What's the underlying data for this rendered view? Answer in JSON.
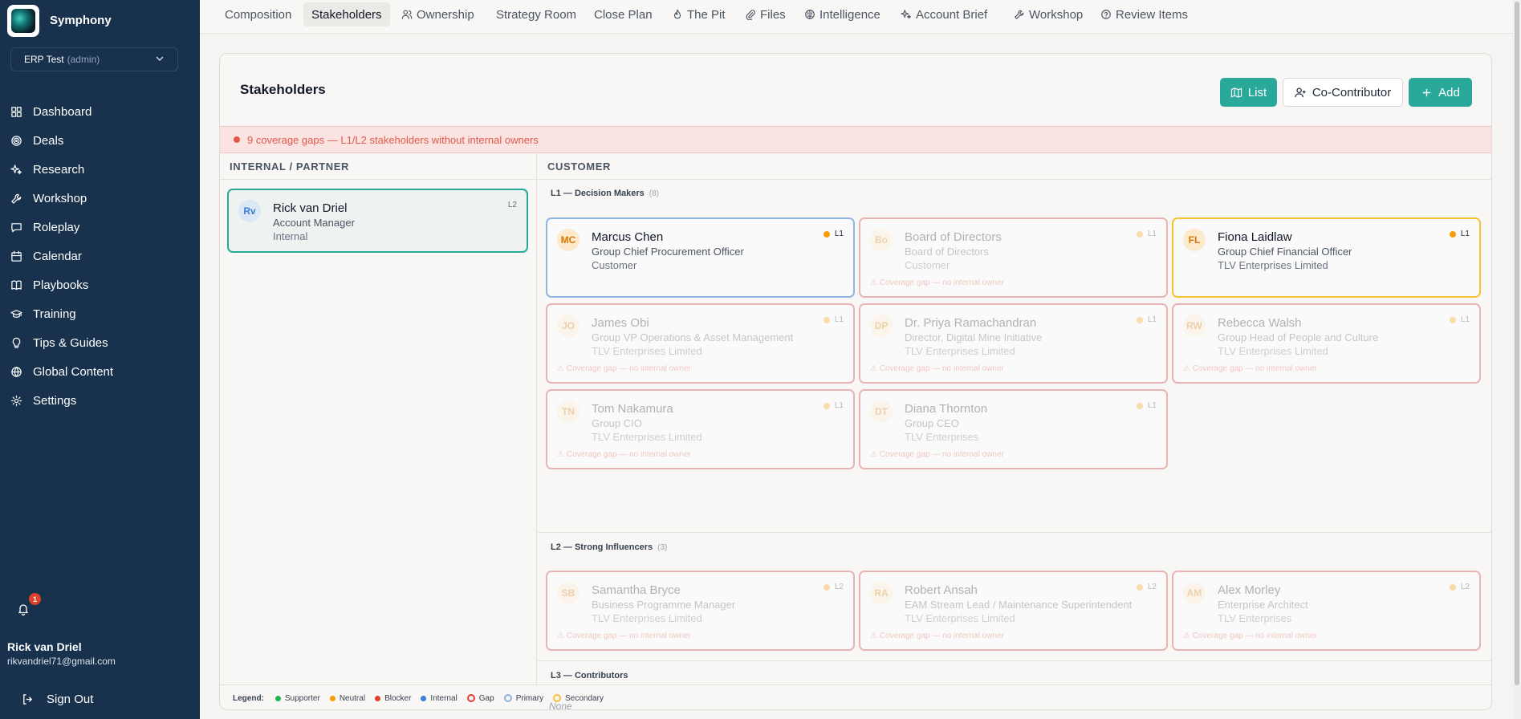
{
  "app": {
    "brand": "Symphony",
    "org": "ERP Test",
    "org_role": "(admin)"
  },
  "nav": [
    {
      "label": "Dashboard",
      "icon": "dashboard-icon"
    },
    {
      "label": "Deals",
      "icon": "target-icon"
    },
    {
      "label": "Research",
      "icon": "sparkle-icon"
    },
    {
      "label": "Workshop",
      "icon": "wrench-icon"
    },
    {
      "label": "Roleplay",
      "icon": "chat-icon"
    },
    {
      "label": "Calendar",
      "icon": "calendar-icon"
    },
    {
      "label": "Playbooks",
      "icon": "book-icon"
    },
    {
      "label": "Training",
      "icon": "graduation-cap-icon"
    },
    {
      "label": "Tips & Guides",
      "icon": "lightbulb-icon"
    },
    {
      "label": "Global Content",
      "icon": "globe-icon"
    },
    {
      "label": "Settings",
      "icon": "gear-icon"
    }
  ],
  "notifications": {
    "count": "1"
  },
  "user": {
    "name": "Rick van Driel",
    "email": "rikvandriel71@gmail.com",
    "signout": "Sign Out"
  },
  "tabs": [
    {
      "label": "Composition",
      "icon": ""
    },
    {
      "label": "Stakeholders",
      "icon": "",
      "active": true
    },
    {
      "label": "Ownership",
      "icon": "users-icon"
    },
    {
      "label": "Strategy Room",
      "icon": ""
    },
    {
      "label": "Close Plan",
      "icon": ""
    },
    {
      "label": "The Pit",
      "icon": "fire-icon"
    },
    {
      "label": "Files",
      "icon": "paperclip-icon"
    },
    {
      "label": "Intelligence",
      "icon": "brain-icon"
    },
    {
      "label": "Account Brief",
      "icon": "sparkle-icon"
    },
    {
      "label": "Workshop",
      "icon": "wrench-icon"
    },
    {
      "label": "Review Items",
      "icon": "help-circle-icon"
    }
  ],
  "panel": {
    "title": "Stakeholders",
    "buttons": {
      "list": "List",
      "cocontributor": "Co-Contributor",
      "add": "Add"
    },
    "gap_banner": "9 coverage gaps — L1/L2 stakeholders without internal owners",
    "internal_head": "INTERNAL / PARTNER",
    "customer_head": "CUSTOMER"
  },
  "internal": [
    {
      "initials": "Rv",
      "name": "Rick van Driel",
      "title": "Account Manager",
      "org": "Internal",
      "level": "L2"
    }
  ],
  "sections": [
    {
      "label": "L1 — Decision Makers",
      "count": "(8)"
    },
    {
      "label": "L2 — Strong Influencers",
      "count": "(3)"
    },
    {
      "label": "L3 — Contributors",
      "count": "",
      "empty": "None"
    }
  ],
  "gap_note": "⚠ Coverage gap — no internal owner",
  "l1": [
    {
      "initials": "MC",
      "name": "Marcus Chen",
      "title": "Group Chief Procurement Officer",
      "org": "Customer",
      "level": "L1",
      "border": "#8fb5e3",
      "faded": false,
      "av": "orange",
      "gap": false
    },
    {
      "initials": "Bo",
      "name": "Board of Directors",
      "title": "Board of Directors",
      "org": "Customer",
      "level": "L1",
      "border": "#eab4b4",
      "faded": true,
      "av": "orange",
      "gap": true
    },
    {
      "initials": "FL",
      "name": "Fiona Laidlaw",
      "title": "Group Chief Financial Officer",
      "org": "TLV Enterprises Limited",
      "level": "L1",
      "border": "#f4c233",
      "faded": false,
      "av": "orange",
      "gap": false
    },
    {
      "initials": "JO",
      "name": "James Obi",
      "title": "Group VP Operations & Asset Management",
      "org": "TLV Enterprises Limited",
      "level": "L1",
      "border": "#eab4b4",
      "faded": true,
      "av": "orange",
      "gap": true
    },
    {
      "initials": "DP",
      "name": "Dr. Priya Ramachandran",
      "title": "Director, Digital Mine Initiative",
      "org": "TLV Enterprises Limited",
      "level": "L1",
      "border": "#eab4b4",
      "faded": true,
      "av": "orange",
      "gap": true
    },
    {
      "initials": "RW",
      "name": "Rebecca Walsh",
      "title": "Group Head of People and Culture",
      "org": "TLV Enterprises Limited",
      "level": "L1",
      "border": "#eab4b4",
      "faded": true,
      "av": "orange",
      "gap": true
    },
    {
      "initials": "TN",
      "name": "Tom Nakamura",
      "title": "Group CIO",
      "org": "TLV Enterprises Limited",
      "level": "L1",
      "border": "#eab4b4",
      "faded": true,
      "av": "orange",
      "gap": true
    },
    {
      "initials": "DT",
      "name": "Diana Thornton",
      "title": "Group CEO",
      "org": "TLV Enterprises",
      "level": "L1",
      "border": "#eab4b4",
      "faded": true,
      "av": "orange",
      "gap": true
    }
  ],
  "l2": [
    {
      "initials": "SB",
      "name": "Samantha Bryce",
      "title": "Business Programme Manager",
      "org": "TLV Enterprises Limited",
      "level": "L2",
      "border": "#eab4b4",
      "faded": true,
      "av": "orange",
      "gap": true
    },
    {
      "initials": "RA",
      "name": "Robert Ansah",
      "title": "EAM Stream Lead / Maintenance Superintendent",
      "org": "TLV Enterprises Limited",
      "level": "L2",
      "border": "#eab4b4",
      "faded": true,
      "av": "orange",
      "gap": true
    },
    {
      "initials": "AM",
      "name": "Alex Morley",
      "title": "Enterprise Architect",
      "org": "TLV Enterprises",
      "level": "L2",
      "border": "#eab4b4",
      "faded": true,
      "av": "orange",
      "gap": true
    }
  ],
  "legend": {
    "label": "Legend:",
    "items": [
      {
        "label": "Supporter",
        "color": "#22b357",
        "kind": "dot"
      },
      {
        "label": "Neutral",
        "color": "#f59e0b",
        "kind": "dot"
      },
      {
        "label": "Blocker",
        "color": "#e0412f",
        "kind": "dot"
      },
      {
        "label": "Internal",
        "color": "#3b7dd8",
        "kind": "dot"
      },
      {
        "label": "Gap",
        "color": "#e0412f",
        "kind": "ring"
      },
      {
        "label": "Primary",
        "color": "#8fb5e3",
        "kind": "ring"
      },
      {
        "label": "Secondary",
        "color": "#f4c233",
        "kind": "ring"
      }
    ]
  }
}
